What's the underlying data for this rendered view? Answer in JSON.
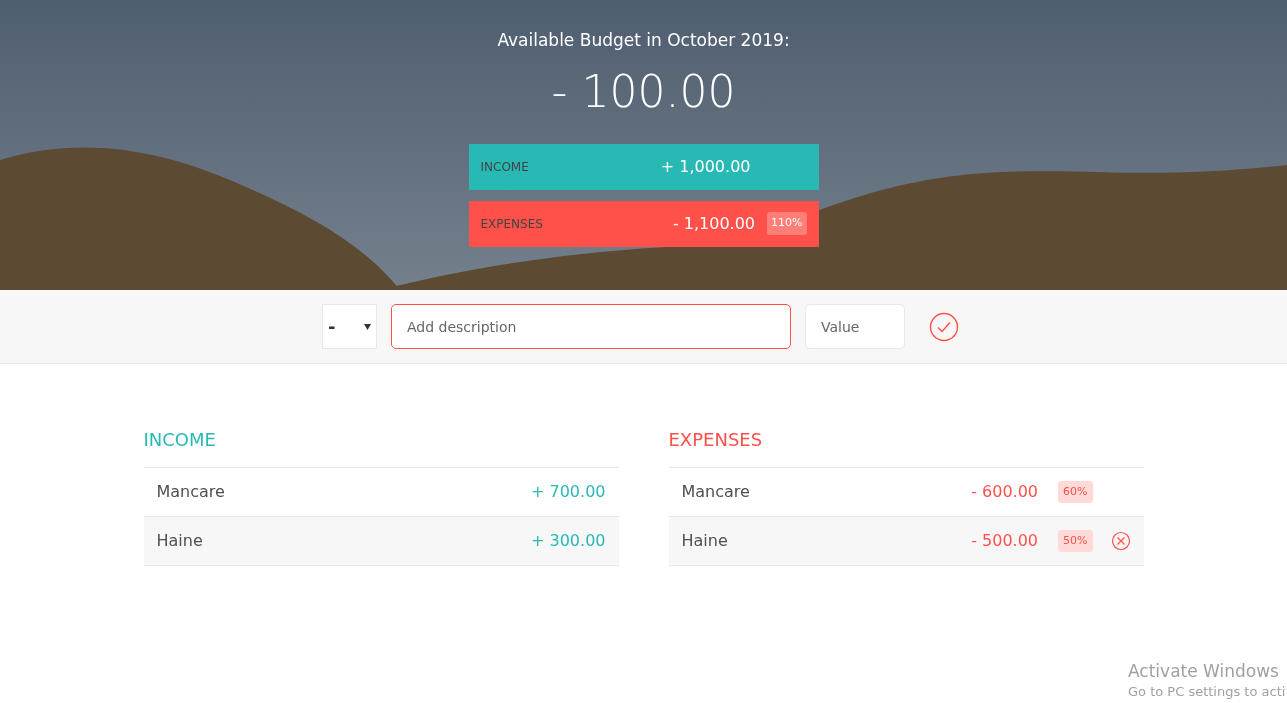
{
  "header": {
    "title": "Available Budget in October 2019:",
    "budget": "- 100.00",
    "summary": [
      {
        "kind": "income",
        "label": "INCOME",
        "value": "+ 1,000.00"
      },
      {
        "kind": "expense",
        "label": "EXPENSES",
        "value": "- 1,100.00",
        "percentage": "110%"
      }
    ]
  },
  "add_bar": {
    "type_select": "-",
    "description": {
      "placeholder": "Add description",
      "focused": true
    },
    "value": {
      "placeholder": "Value"
    }
  },
  "income": {
    "title": "INCOME",
    "items": [
      {
        "description": "Mancare",
        "value": "+ 700.00",
        "hovered": false
      },
      {
        "description": "Haine",
        "value": "+ 300.00",
        "hovered": false
      }
    ]
  },
  "expenses": {
    "title": "EXPENSES",
    "items": [
      {
        "description": "Mancare",
        "value": "- 600.00",
        "percentage": "60%",
        "hovered": false
      },
      {
        "description": "Haine",
        "value": "- 500.00",
        "percentage": "50%",
        "hovered": true
      }
    ]
  },
  "os_notice": {
    "title": "Activate Windows",
    "subtitle": "Go to PC settings to acti"
  }
}
